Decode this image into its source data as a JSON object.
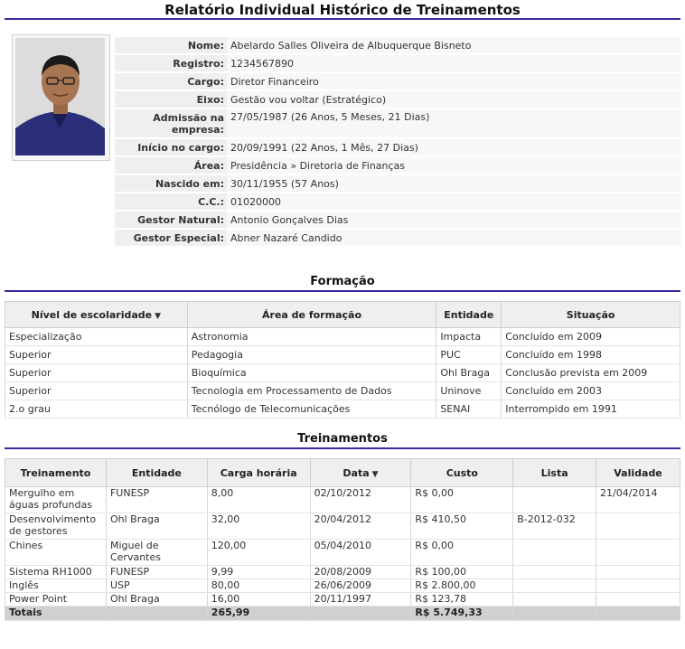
{
  "page_title": "Relatório Individual Histórico de Treinamentos",
  "employee": [
    {
      "label": "Nome:",
      "value": "Abelardo Salles Oliveira de Albuquerque Bisneto"
    },
    {
      "label": "Registro:",
      "value": "1234567890"
    },
    {
      "label": "Cargo:",
      "value": "Diretor Financeiro"
    },
    {
      "label": "Eixo:",
      "value": "Gestão vou voltar (Estratégico)"
    },
    {
      "label": "Admissão na empresa:",
      "value": "27/05/1987 (26 Anos, 5 Meses, 21 Dias)"
    },
    {
      "label": "Início no cargo:",
      "value": "20/09/1991 (22 Anos, 1 Mês, 27 Dias)"
    },
    {
      "label": "Área:",
      "value": "Presidência » Diretoria de Finanças"
    },
    {
      "label": "Nascido em:",
      "value": "30/11/1955 (57 Anos)"
    },
    {
      "label": "C.C.:",
      "value": "01020000"
    },
    {
      "label": "Gestor Natural:",
      "value": "Antonio Gonçalves Dias"
    },
    {
      "label": "Gestor Especial:",
      "value": "Abner Nazaré Candido"
    }
  ],
  "formacao": {
    "title": "Formação",
    "headers": [
      "Nível de escolaridade",
      "Área de formação",
      "Entidade",
      "Situação"
    ],
    "sort_icon": "caret-down-icon",
    "rows": [
      [
        "Especialização",
        "Astronomia",
        "Impacta",
        "Concluído em 2009"
      ],
      [
        "Superior",
        "Pedagogia",
        "PUC",
        "Concluído em 1998"
      ],
      [
        "Superior",
        "Bioquímica",
        "Ohl Braga",
        "Conclusão prevista em 2009"
      ],
      [
        "Superior",
        "Tecnologia em Processamento de Dados",
        "Uninove",
        "Concluído em 2003"
      ],
      [
        "2.o grau",
        "Tecnólogo de Telecomunicações",
        "SENAI",
        "Interrompido em 1991"
      ]
    ]
  },
  "treinamentos": {
    "title": "Treinamentos",
    "headers": [
      "Treinamento",
      "Entidade",
      "Carga horária",
      "Data",
      "Custo",
      "Lista",
      "Validade"
    ],
    "rows": [
      [
        "Mergulho em águas profundas",
        "FUNESP",
        "8,00",
        "02/10/2012",
        "R$ 0,00",
        "",
        "21/04/2014"
      ],
      [
        "Desenvolvimento de gestores",
        "Ohl Braga",
        "32,00",
        "20/04/2012",
        "R$ 410,50",
        "B-2012-032",
        ""
      ],
      [
        "Chines",
        "Miguel de Cervantes",
        "120,00",
        "05/04/2010",
        "R$ 0,00",
        "",
        ""
      ],
      [
        "Sistema RH1000",
        "FUNESP",
        "9,99",
        "20/08/2009",
        "R$ 100,00",
        "",
        ""
      ],
      [
        "Inglês",
        "USP",
        "80,00",
        "26/06/2009",
        "R$ 2.800,00",
        "",
        ""
      ],
      [
        "Power Point",
        "Ohl Braga",
        "16,00",
        "20/11/1997",
        "R$ 123,78",
        "",
        ""
      ]
    ],
    "totals": {
      "label": "Totais",
      "carga": "265,99",
      "custo": "R$ 5.749,33"
    }
  },
  "colors": {
    "accent_rule": "#3a2aa0",
    "header_bg": "#efefef",
    "totals_bg": "#d0d0d0"
  }
}
